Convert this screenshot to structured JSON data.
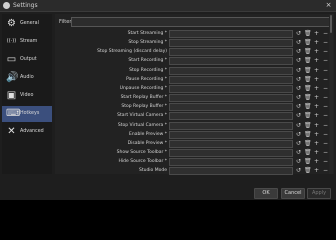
{
  "window": {
    "title": "Settings",
    "close_glyph": "×"
  },
  "sidebar": {
    "items": [
      {
        "label": "General",
        "icon": "gear-icon",
        "glyph": "⚙",
        "active": false
      },
      {
        "label": "Stream",
        "icon": "stream-icon",
        "glyph": "((·))",
        "active": false
      },
      {
        "label": "Output",
        "icon": "output-icon",
        "glyph": "▭",
        "active": false
      },
      {
        "label": "Audio",
        "icon": "audio-icon",
        "glyph": "🔊",
        "active": false
      },
      {
        "label": "Video",
        "icon": "video-icon",
        "glyph": "▣",
        "active": false
      },
      {
        "label": "Hotkeys",
        "icon": "keyboard-icon",
        "glyph": "⌨",
        "active": true
      },
      {
        "label": "Advanced",
        "icon": "tools-icon",
        "glyph": "✕",
        "active": false
      }
    ]
  },
  "filter": {
    "label": "Filter"
  },
  "hotkeys": [
    "Start Streaming *",
    "Stop Streaming *",
    "Stop Streaming (discard delay)",
    "Start Recording *",
    "Stop Recording *",
    "Pause Recording *",
    "Unpause Recording *",
    "Start Replay Buffer *",
    "Stop Replay Buffer *",
    "Start Virtual Camera *",
    "Stop Virtual Camera *",
    "Enable Preview *",
    "Disable Preview *",
    "Show Source Toolbar *",
    "Hide Source Toolbar *",
    "Studio Mode"
  ],
  "controls": {
    "revert": "↺",
    "delete": "🗑",
    "add": "+",
    "remove": "−"
  },
  "buttons": {
    "ok": "OK",
    "cancel": "Cancel",
    "apply": "Apply"
  },
  "colors": {
    "active_item": "#3b4f7d",
    "background": "#1e1e1e"
  }
}
